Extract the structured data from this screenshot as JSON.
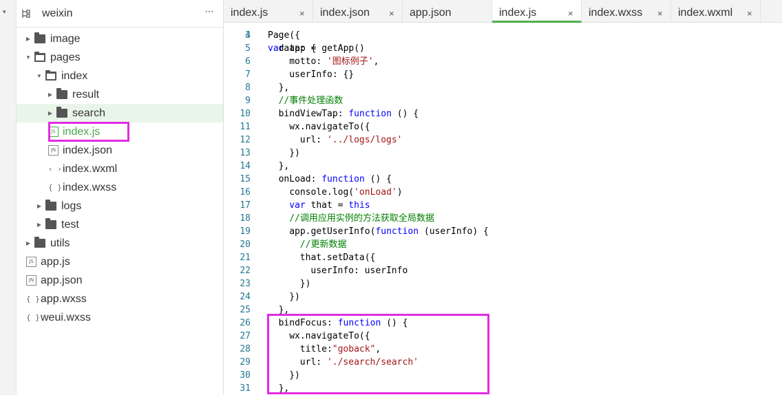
{
  "sidebar": {
    "project_name": "weixin",
    "more_label": "···",
    "tree": [
      {
        "label": "image",
        "kind": "folder",
        "open": false,
        "depth": 0
      },
      {
        "label": "pages",
        "kind": "folder",
        "open": true,
        "depth": 0
      },
      {
        "label": "index",
        "kind": "folder",
        "open": true,
        "depth": 1
      },
      {
        "label": "result",
        "kind": "folder",
        "open": false,
        "depth": 2
      },
      {
        "label": "search",
        "kind": "folder",
        "open": false,
        "depth": 2,
        "selected": true
      },
      {
        "label": "index.js",
        "kind": "file",
        "icon": "JS",
        "depth": 2,
        "highlight": true
      },
      {
        "label": "index.json",
        "kind": "file",
        "icon": "JN",
        "depth": 2
      },
      {
        "label": "index.wxml",
        "kind": "file",
        "icon": "<>",
        "depth": 2
      },
      {
        "label": "index.wxss",
        "kind": "file",
        "icon": "{}",
        "depth": 2
      },
      {
        "label": "logs",
        "kind": "folder",
        "open": false,
        "depth": 1
      },
      {
        "label": "test",
        "kind": "folder",
        "open": false,
        "depth": 1
      },
      {
        "label": "utils",
        "kind": "folder",
        "open": false,
        "depth": 0
      },
      {
        "label": "app.js",
        "kind": "file",
        "icon": "JS",
        "depth": 0
      },
      {
        "label": "app.json",
        "kind": "file",
        "icon": "JN",
        "depth": 0
      },
      {
        "label": "app.wxss",
        "kind": "file",
        "icon": "{}",
        "depth": 0
      },
      {
        "label": "weui.wxss",
        "kind": "file",
        "icon": "{}",
        "depth": 0
      }
    ]
  },
  "tabs": [
    {
      "label": "index.js",
      "closable": true,
      "active": false
    },
    {
      "label": "index.json",
      "closable": true,
      "active": false
    },
    {
      "label": "app.json",
      "closable": false,
      "active": false
    },
    {
      "label": "index.js",
      "closable": true,
      "active": true
    },
    {
      "label": "index.wxss",
      "closable": true,
      "active": false
    },
    {
      "label": "index.wxml",
      "closable": true,
      "active": false
    }
  ],
  "close_glyph": "×",
  "code": [
    {
      "n": "4",
      "indent": 0,
      "parts": [
        [
          "plain",
          "Page({"
        ]
      ]
    },
    {
      "n": "5",
      "indent": 1,
      "parts": [
        [
          "prop",
          "data"
        ],
        [
          "plain",
          ": {"
        ]
      ]
    },
    {
      "n": "6",
      "indent": 2,
      "parts": [
        [
          "prop",
          "motto"
        ],
        [
          "plain",
          ": "
        ],
        [
          "str",
          "'图标例子'"
        ],
        [
          "plain",
          ","
        ]
      ]
    },
    {
      "n": "7",
      "indent": 2,
      "parts": [
        [
          "prop",
          "userInfo"
        ],
        [
          "plain",
          ": {}"
        ]
      ]
    },
    {
      "n": "8",
      "indent": 1,
      "parts": [
        [
          "plain",
          "},"
        ]
      ]
    },
    {
      "n": "9",
      "indent": 1,
      "parts": [
        [
          "com",
          "//事件处理函数"
        ]
      ]
    },
    {
      "n": "10",
      "indent": 1,
      "parts": [
        [
          "prop",
          "bindViewTap"
        ],
        [
          "plain",
          ": "
        ],
        [
          "kw",
          "function"
        ],
        [
          "plain",
          " () {"
        ]
      ]
    },
    {
      "n": "11",
      "indent": 2,
      "parts": [
        [
          "plain",
          "wx.navigateTo({"
        ]
      ]
    },
    {
      "n": "12",
      "indent": 3,
      "parts": [
        [
          "prop",
          "url"
        ],
        [
          "plain",
          ": "
        ],
        [
          "str",
          "'../logs/logs'"
        ]
      ]
    },
    {
      "n": "13",
      "indent": 2,
      "parts": [
        [
          "plain",
          "})"
        ]
      ]
    },
    {
      "n": "14",
      "indent": 1,
      "parts": [
        [
          "plain",
          "},"
        ]
      ]
    },
    {
      "n": "15",
      "indent": 1,
      "parts": [
        [
          "prop",
          "onLoad"
        ],
        [
          "plain",
          ": "
        ],
        [
          "kw",
          "function"
        ],
        [
          "plain",
          " () {"
        ]
      ]
    },
    {
      "n": "16",
      "indent": 2,
      "parts": [
        [
          "plain",
          "console.log("
        ],
        [
          "str",
          "'onLoad'"
        ],
        [
          "plain",
          ")"
        ]
      ]
    },
    {
      "n": "17",
      "indent": 2,
      "parts": [
        [
          "kw",
          "var"
        ],
        [
          "plain",
          " that = "
        ],
        [
          "kw",
          "this"
        ]
      ]
    },
    {
      "n": "18",
      "indent": 2,
      "parts": [
        [
          "com",
          "//调用应用实例的方法获取全局数据"
        ]
      ]
    },
    {
      "n": "19",
      "indent": 2,
      "parts": [
        [
          "plain",
          "app.getUserInfo("
        ],
        [
          "kw",
          "function"
        ],
        [
          "plain",
          " (userInfo) {"
        ]
      ]
    },
    {
      "n": "20",
      "indent": 3,
      "parts": [
        [
          "com",
          "//更新数据"
        ]
      ]
    },
    {
      "n": "21",
      "indent": 3,
      "parts": [
        [
          "plain",
          "that.setData({"
        ]
      ]
    },
    {
      "n": "22",
      "indent": 4,
      "parts": [
        [
          "prop",
          "userInfo"
        ],
        [
          "plain",
          ": userInfo"
        ]
      ]
    },
    {
      "n": "23",
      "indent": 3,
      "parts": [
        [
          "plain",
          "})"
        ]
      ]
    },
    {
      "n": "24",
      "indent": 2,
      "parts": [
        [
          "plain",
          "})"
        ]
      ]
    },
    {
      "n": "25",
      "indent": 1,
      "parts": [
        [
          "plain",
          "},"
        ]
      ]
    },
    {
      "n": "26",
      "indent": 1,
      "parts": [
        [
          "prop",
          "bindFocus"
        ],
        [
          "plain",
          ": "
        ],
        [
          "kw",
          "function"
        ],
        [
          "plain",
          " () {"
        ]
      ]
    },
    {
      "n": "27",
      "indent": 2,
      "parts": [
        [
          "plain",
          "wx.navigateTo({"
        ]
      ]
    },
    {
      "n": "28",
      "indent": 3,
      "parts": [
        [
          "prop",
          "title"
        ],
        [
          "plain",
          ":"
        ],
        [
          "str",
          "\"goback\""
        ],
        [
          "plain",
          ","
        ]
      ]
    },
    {
      "n": "29",
      "indent": 3,
      "parts": [
        [
          "prop",
          "url"
        ],
        [
          "plain",
          ": "
        ],
        [
          "str",
          "'./search/search'"
        ]
      ]
    },
    {
      "n": "30",
      "indent": 2,
      "parts": [
        [
          "plain",
          "})"
        ]
      ]
    },
    {
      "n": "31",
      "indent": 1,
      "parts": [
        [
          "plain",
          "},"
        ]
      ]
    }
  ],
  "colors": {
    "highlight_box": "#e22ce2",
    "active_tab_underline": "#4caf50",
    "selected_row_bg": "#eaf5ea",
    "keyword": "#0000ff",
    "string": "#a31515",
    "comment": "#008000",
    "line_number": "#237893"
  }
}
